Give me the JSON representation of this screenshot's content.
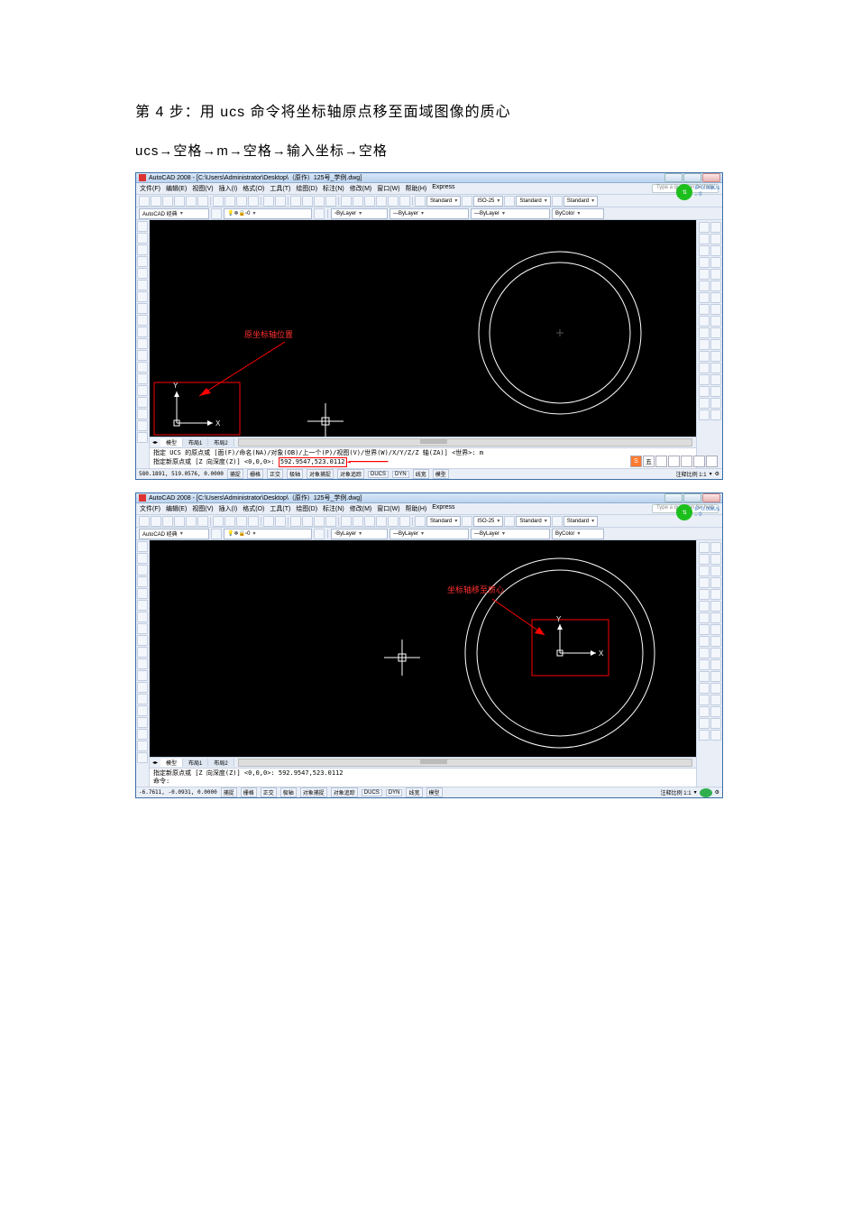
{
  "doc": {
    "heading": "第 4 步：用 ucs 命令将坐标轴原点移至面域图像的质心",
    "sub": "ucs→空格→m→空格→输入坐标→空格"
  },
  "app": {
    "title": "AutoCAD 2008 - [C:\\Users\\Administrator\\Desktop\\（原作）125号_学例.dwg]",
    "help_hint": "Type a question for help"
  },
  "menus": [
    "文件(F)",
    "编辑(E)",
    "视图(V)",
    "插入(I)",
    "格式(O)",
    "工具(T)",
    "绘图(D)",
    "标注(N)",
    "修改(M)",
    "窗口(W)",
    "帮助(H)",
    "Express"
  ],
  "combos": {
    "textstyle": "Standard",
    "dimscale": "ISO-25",
    "dimstyle": "Standard",
    "tablestyle": "Standard",
    "layer_combo": "AutoCAD 经典",
    "layer_name": "0",
    "linetype": "ByLayer",
    "lineweight": "ByLayer",
    "color": "ByColor"
  },
  "net": {
    "label1": "IP 0.00K/s",
    "label2": "↓ 0"
  },
  "tabs": {
    "model": "模型",
    "layout1": "布局1",
    "layout2": "布局2"
  },
  "shot1": {
    "annot": "原坐标轴位置",
    "cmd1": "指定 UCS 的原点或 [面(F)/命名(NA)/对象(OB)/上一个(P)/视图(V)/世界(W)/X/Y/Z/Z 轴(ZA)] <世界>: m",
    "cmd2_prefix": "指定新原点或 [Z 向深度(Z)] <0,0,0>: ",
    "cmd2_coord": "592.9547,523.0112",
    "coords": "580.1891, 519.0576, 0.0000"
  },
  "shot2": {
    "annot": "坐标轴移至质心",
    "cmd1": "指定新原点或 [Z 向深度(Z)] <0,0,0>: 592.9547,523.0112",
    "cmd2": "命令:",
    "coords": "-6.7611, -0.0931, 0.0000"
  },
  "status_buttons": [
    "捕捉",
    "栅格",
    "正交",
    "极轴",
    "对象捕捉",
    "对象追踪",
    "DUCS",
    "DYN",
    "线宽",
    "模型"
  ],
  "status_right": "注释比例 1:1",
  "ime": [
    "S",
    "五",
    "",
    "",
    "",
    "",
    ""
  ]
}
